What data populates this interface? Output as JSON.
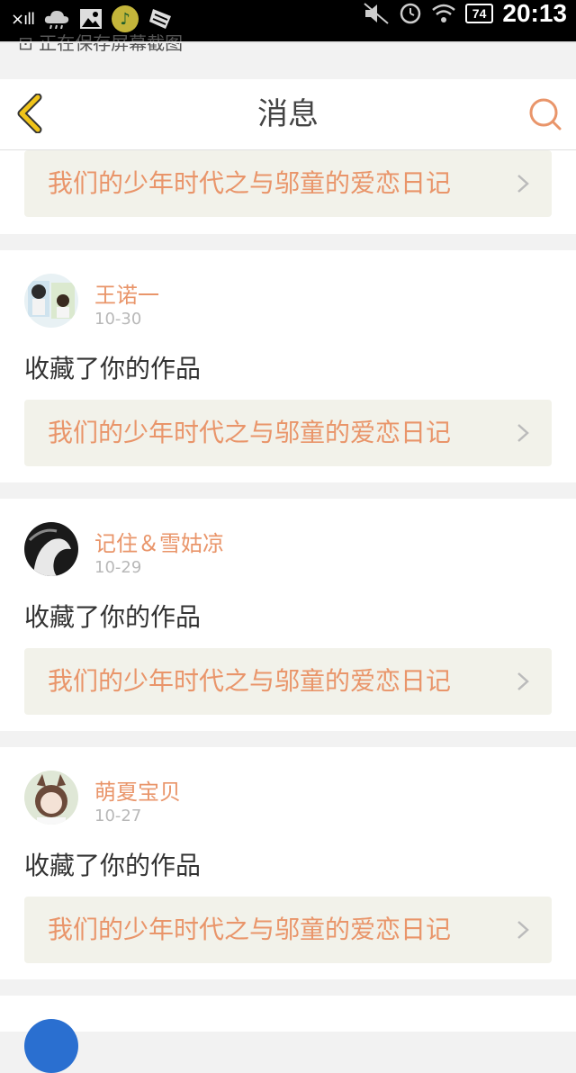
{
  "status_bar": {
    "signal": "×ıll",
    "time": "20:13",
    "battery": "74",
    "notice": "正在保存屏幕截图"
  },
  "header": {
    "title": "消息"
  },
  "feed": {
    "first_partial": {
      "work_title": "我们的少年时代之与邬童的爱恋日记"
    },
    "items": [
      {
        "username": "王诺一",
        "date": "10-30",
        "action": "收藏了你的作品",
        "work_title": "我们的少年时代之与邬童的爱恋日记"
      },
      {
        "username": "记住＆雪姑凉",
        "date": "10-29",
        "action": "收藏了你的作品",
        "work_title": "我们的少年时代之与邬童的爱恋日记"
      },
      {
        "username": "萌夏宝贝",
        "date": "10-27",
        "action": "收藏了你的作品",
        "work_title": "我们的少年时代之与邬童的爱恋日记"
      }
    ]
  },
  "colors": {
    "accent": "#e9956a",
    "back_icon": "#f0c419",
    "work_box_bg": "#f2f2ea"
  }
}
